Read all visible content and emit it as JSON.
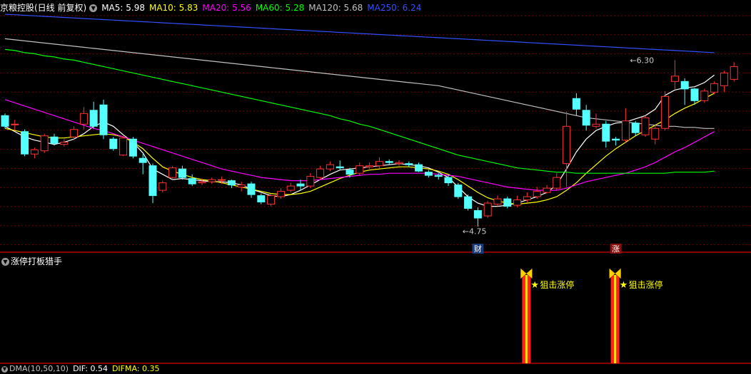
{
  "header": {
    "stock_name": "京粮控股(日线 前复权)",
    "ma_labels": [
      {
        "text": "MA5: 5.98",
        "color": "#ffffff"
      },
      {
        "text": "MA10: 5.83",
        "color": "#ffff00"
      },
      {
        "text": "MA20: 5.56",
        "color": "#ff00ff"
      },
      {
        "text": "MA60: 5.28",
        "color": "#00ff00"
      },
      {
        "text": "MA120: 5.68",
        "color": "#c0c0c0"
      },
      {
        "text": "MA250: 6.24",
        "color": "#3050ff"
      }
    ]
  },
  "sub_panel": {
    "title": "涨停打板猎手",
    "signals": [
      {
        "index": 53,
        "label": "狙击涨停"
      },
      {
        "index": 62,
        "label": "狙击涨停"
      }
    ]
  },
  "bottom_panel": {
    "items": [
      {
        "text": "DMA(10,50,10)",
        "color": "#c0c0c0"
      },
      {
        "text": "DIF: 0.54",
        "color": "#ffffff"
      },
      {
        "text": "DIFMA: 0.35",
        "color": "#ffff00"
      }
    ]
  },
  "colors": {
    "up": "#ff3232",
    "down": "#54ffff",
    "grid": "#7a0000",
    "divider": "#b00000",
    "signal_bar": "#ff2020",
    "signal_core": "#ffe000",
    "signal_text": "#ffff00"
  },
  "icons": [
    "chevron-down-icon",
    "star-icon",
    "bowtie-icon"
  ],
  "chart_data": {
    "type": "candlestick",
    "ylim": [
      4.6,
      6.75
    ],
    "annotations": [
      {
        "index": 63,
        "value": 6.3,
        "text": "6.30"
      },
      {
        "index": 46,
        "value": 4.75,
        "text": "4.75"
      }
    ],
    "markers": [
      {
        "index": 48,
        "text": "财"
      },
      {
        "index": 62,
        "text": "涨"
      }
    ],
    "candles": [
      [
        5.8,
        5.7,
        5.82,
        5.68
      ],
      [
        5.72,
        5.72,
        5.76,
        5.66
      ],
      [
        5.65,
        5.44,
        5.67,
        5.42
      ],
      [
        5.44,
        5.48,
        5.5,
        5.4
      ],
      [
        5.47,
        5.61,
        5.63,
        5.45
      ],
      [
        5.6,
        5.54,
        5.63,
        5.52
      ],
      [
        5.53,
        5.55,
        5.58,
        5.51
      ],
      [
        5.6,
        5.67,
        5.7,
        5.57
      ],
      [
        5.72,
        5.82,
        5.88,
        5.67
      ],
      [
        5.85,
        5.7,
        5.93,
        5.68
      ],
      [
        5.9,
        5.62,
        5.95,
        5.58
      ],
      [
        5.58,
        5.49,
        5.6,
        5.47
      ],
      [
        5.43,
        5.59,
        5.61,
        5.42
      ],
      [
        5.58,
        5.42,
        5.6,
        5.4
      ],
      [
        5.4,
        5.36,
        5.44,
        5.25
      ],
      [
        5.33,
        5.05,
        5.35,
        4.98
      ],
      [
        5.1,
        5.17,
        5.19,
        5.08
      ],
      [
        5.22,
        5.31,
        5.33,
        5.2
      ],
      [
        5.3,
        5.22,
        5.33,
        5.2
      ],
      [
        5.21,
        5.16,
        5.25,
        5.14
      ],
      [
        5.17,
        5.18,
        5.21,
        5.15
      ],
      [
        5.18,
        5.2,
        5.22,
        5.16
      ],
      [
        5.2,
        5.2,
        5.23,
        5.16
      ],
      [
        5.19,
        5.15,
        5.2,
        5.12
      ],
      [
        5.13,
        5.15,
        5.18,
        5.09
      ],
      [
        5.16,
        5.06,
        5.18,
        5.03
      ],
      [
        5.05,
        4.99,
        5.07,
        4.97
      ],
      [
        4.97,
        5.05,
        5.07,
        4.95
      ],
      [
        5.04,
        5.09,
        5.12,
        5.02
      ],
      [
        5.1,
        5.14,
        5.17,
        5.08
      ],
      [
        5.16,
        5.14,
        5.2,
        5.1
      ],
      [
        5.14,
        5.23,
        5.26,
        5.12
      ],
      [
        5.22,
        5.3,
        5.33,
        5.2
      ],
      [
        5.3,
        5.34,
        5.37,
        5.28
      ],
      [
        5.32,
        5.31,
        5.38,
        5.29
      ],
      [
        5.29,
        5.25,
        5.31,
        5.22
      ],
      [
        5.26,
        5.33,
        5.36,
        5.24
      ],
      [
        5.32,
        5.33,
        5.36,
        5.3
      ],
      [
        5.33,
        5.37,
        5.41,
        5.31
      ],
      [
        5.37,
        5.36,
        5.39,
        5.34
      ],
      [
        5.35,
        5.36,
        5.38,
        5.33
      ],
      [
        5.35,
        5.34,
        5.37,
        5.32
      ],
      [
        5.34,
        5.28,
        5.36,
        5.27
      ],
      [
        5.27,
        5.24,
        5.29,
        5.22
      ],
      [
        5.24,
        5.23,
        5.26,
        5.2
      ],
      [
        5.22,
        5.17,
        5.24,
        5.14
      ],
      [
        5.15,
        5.04,
        5.17,
        5.02
      ],
      [
        5.04,
        4.93,
        5.06,
        4.91
      ],
      [
        4.91,
        4.84,
        4.94,
        4.76
      ],
      [
        4.86,
        4.98,
        5.0,
        4.84
      ],
      [
        4.97,
        5.02,
        5.05,
        4.95
      ],
      [
        5.02,
        4.95,
        5.04,
        4.93
      ],
      [
        4.96,
        5.01,
        5.05,
        4.94
      ],
      [
        5.01,
        5.04,
        5.08,
        4.99
      ],
      [
        5.04,
        5.09,
        5.13,
        5.02
      ],
      [
        5.08,
        5.12,
        5.15,
        5.07
      ],
      [
        5.12,
        5.22,
        5.26,
        5.1
      ],
      [
        5.35,
        5.7,
        5.84,
        5.13
      ],
      [
        5.96,
        5.86,
        6.01,
        5.8
      ],
      [
        5.85,
        5.71,
        5.9,
        5.66
      ],
      [
        5.7,
        5.72,
        5.82,
        5.68
      ],
      [
        5.72,
        5.56,
        5.75,
        5.5
      ],
      [
        5.58,
        5.57,
        5.6,
        5.52
      ],
      [
        5.57,
        5.75,
        5.87,
        5.55
      ],
      [
        5.73,
        5.64,
        5.75,
        5.61
      ],
      [
        5.62,
        5.78,
        5.8,
        5.6
      ],
      [
        5.58,
        5.68,
        5.72,
        5.53
      ],
      [
        5.68,
        5.98,
        6.03,
        5.66
      ],
      [
        6.12,
        6.17,
        6.32,
        6.05
      ],
      [
        6.12,
        6.05,
        6.15,
        5.9
      ],
      [
        6.05,
        5.94,
        6.06,
        5.9
      ],
      [
        5.94,
        6.03,
        6.05,
        5.92
      ],
      [
        6.02,
        6.1,
        6.12,
        6.0
      ],
      [
        6.08,
        6.2,
        6.22,
        6.02
      ],
      [
        6.14,
        6.26,
        6.3,
        6.12
      ]
    ],
    "series": [
      {
        "name": "MA5",
        "color": "#ffffff",
        "values": [
          5.7,
          5.65,
          5.6,
          5.57,
          5.55,
          5.53,
          5.55,
          5.58,
          5.63,
          5.7,
          5.74,
          5.7,
          5.62,
          5.55,
          5.45,
          5.3,
          5.25,
          5.2,
          5.21,
          5.2,
          5.19,
          5.18,
          5.18,
          5.17,
          5.15,
          5.11,
          5.08,
          5.05,
          5.04,
          5.06,
          5.1,
          5.15,
          5.2,
          5.25,
          5.29,
          5.3,
          5.31,
          5.32,
          5.33,
          5.34,
          5.35,
          5.34,
          5.33,
          5.31,
          5.27,
          5.22,
          5.13,
          5.04,
          4.98,
          4.95,
          4.95,
          4.96,
          4.98,
          5.01,
          5.04,
          5.08,
          5.15,
          5.3,
          5.46,
          5.58,
          5.66,
          5.7,
          5.73,
          5.74,
          5.77,
          5.8,
          5.86,
          5.99,
          6.04,
          6.06,
          6.07,
          6.11,
          6.18
        ]
      },
      {
        "name": "MA10",
        "color": "#ffff00",
        "values": [
          5.68,
          5.66,
          5.64,
          5.62,
          5.6,
          5.59,
          5.59,
          5.6,
          5.61,
          5.62,
          5.63,
          5.62,
          5.6,
          5.55,
          5.49,
          5.4,
          5.32,
          5.28,
          5.25,
          5.22,
          5.2,
          5.19,
          5.17,
          5.15,
          5.13,
          5.11,
          5.09,
          5.07,
          5.06,
          5.06,
          5.07,
          5.09,
          5.13,
          5.17,
          5.21,
          5.24,
          5.27,
          5.29,
          5.3,
          5.31,
          5.32,
          5.32,
          5.31,
          5.3,
          5.28,
          5.25,
          5.2,
          5.14,
          5.08,
          5.03,
          5.0,
          4.98,
          4.97,
          4.98,
          4.99,
          5.01,
          5.04,
          5.1,
          5.17,
          5.26,
          5.34,
          5.42,
          5.49,
          5.55,
          5.61,
          5.66,
          5.71,
          5.76,
          5.82,
          5.87,
          5.91,
          5.96,
          6.01
        ]
      },
      {
        "name": "MA20",
        "color": "#ff00ff",
        "values": [
          5.95,
          5.92,
          5.89,
          5.86,
          5.83,
          5.8,
          5.77,
          5.74,
          5.71,
          5.68,
          5.66,
          5.63,
          5.6,
          5.57,
          5.54,
          5.51,
          5.48,
          5.45,
          5.42,
          5.39,
          5.36,
          5.33,
          5.3,
          5.28,
          5.26,
          5.24,
          5.22,
          5.21,
          5.2,
          5.19,
          5.19,
          5.19,
          5.2,
          5.21,
          5.22,
          5.23,
          5.24,
          5.25,
          5.25,
          5.26,
          5.26,
          5.26,
          5.26,
          5.26,
          5.25,
          5.24,
          5.23,
          5.21,
          5.19,
          5.17,
          5.15,
          5.13,
          5.12,
          5.11,
          5.1,
          5.1,
          5.1,
          5.12,
          5.15,
          5.18,
          5.2,
          5.22,
          5.24,
          5.26,
          5.29,
          5.32,
          5.36,
          5.41,
          5.46,
          5.5,
          5.55,
          5.6,
          5.65
        ]
      },
      {
        "name": "MA60",
        "color": "#00ff00",
        "values": [
          6.42,
          6.41,
          6.39,
          6.38,
          6.36,
          6.35,
          6.33,
          6.32,
          6.3,
          6.28,
          6.26,
          6.24,
          6.22,
          6.2,
          6.18,
          6.16,
          6.14,
          6.12,
          6.1,
          6.08,
          6.06,
          6.04,
          6.02,
          6.0,
          5.98,
          5.96,
          5.94,
          5.92,
          5.9,
          5.88,
          5.86,
          5.84,
          5.82,
          5.8,
          5.77,
          5.75,
          5.72,
          5.7,
          5.67,
          5.64,
          5.61,
          5.58,
          5.55,
          5.52,
          5.49,
          5.46,
          5.43,
          5.41,
          5.39,
          5.37,
          5.35,
          5.33,
          5.31,
          5.3,
          5.29,
          5.28,
          5.27,
          5.27,
          5.26,
          5.26,
          5.26,
          5.26,
          5.26,
          5.26,
          5.26,
          5.26,
          5.26,
          5.26,
          5.27,
          5.27,
          5.27,
          5.27,
          5.28
        ]
      },
      {
        "name": "MA120",
        "color": "#c0c0c0",
        "values": [
          6.52,
          6.51,
          6.5,
          6.49,
          6.48,
          6.47,
          6.46,
          6.45,
          6.44,
          6.43,
          6.42,
          6.41,
          6.4,
          6.39,
          6.38,
          6.37,
          6.36,
          6.35,
          6.34,
          6.33,
          6.32,
          6.31,
          6.3,
          6.29,
          6.28,
          6.27,
          6.26,
          6.25,
          6.24,
          6.23,
          6.22,
          6.21,
          6.2,
          6.19,
          6.18,
          6.17,
          6.16,
          6.15,
          6.14,
          6.13,
          6.12,
          6.11,
          6.1,
          6.09,
          6.08,
          6.06,
          6.04,
          6.02,
          6.0,
          5.98,
          5.96,
          5.94,
          5.92,
          5.9,
          5.88,
          5.86,
          5.84,
          5.82,
          5.8,
          5.78,
          5.77,
          5.76,
          5.75,
          5.74,
          5.73,
          5.72,
          5.71,
          5.7,
          5.7,
          5.69,
          5.69,
          5.68,
          5.68
        ]
      },
      {
        "name": "MA250",
        "color": "#3050ff",
        "values": [
          6.75,
          6.745,
          6.74,
          6.735,
          6.73,
          6.725,
          6.72,
          6.715,
          6.71,
          6.705,
          6.7,
          6.695,
          6.69,
          6.685,
          6.68,
          6.675,
          6.67,
          6.665,
          6.66,
          6.655,
          6.65,
          6.645,
          6.64,
          6.635,
          6.63,
          6.625,
          6.62,
          6.615,
          6.61,
          6.605,
          6.6,
          6.595,
          6.59,
          6.585,
          6.58,
          6.575,
          6.57,
          6.565,
          6.56,
          6.555,
          6.55,
          6.545,
          6.54,
          6.535,
          6.53,
          6.525,
          6.52,
          6.515,
          6.51,
          6.505,
          6.5,
          6.495,
          6.49,
          6.485,
          6.48,
          6.475,
          6.47,
          6.465,
          6.46,
          6.455,
          6.45,
          6.445,
          6.44,
          6.435,
          6.43,
          6.425,
          6.42,
          6.415,
          6.41,
          6.405,
          6.4,
          6.395,
          6.39
        ]
      }
    ]
  }
}
